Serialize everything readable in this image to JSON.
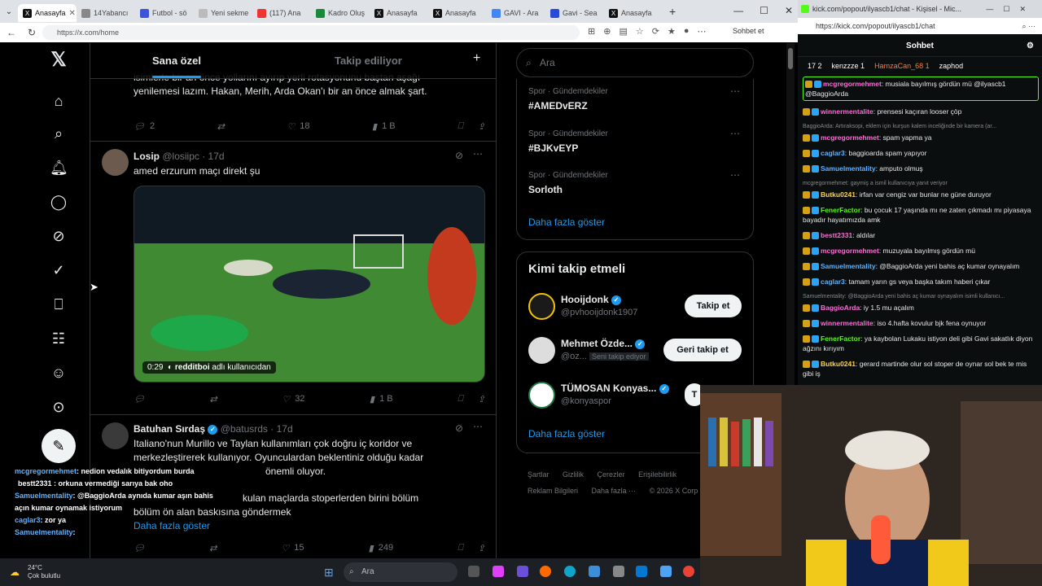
{
  "browser_left": {
    "tabs": [
      {
        "label": "Anasayfa",
        "active": true
      },
      {
        "label": "14Yabancı",
        "active": false
      },
      {
        "label": "Futbol - sö",
        "active": false
      },
      {
        "label": "Yeni sekme",
        "active": false
      },
      {
        "label": "(117) Ana",
        "active": false
      },
      {
        "label": "Kadro Oluş",
        "active": false
      },
      {
        "label": "Anasayfa",
        "active": false
      },
      {
        "label": "Anasayfa",
        "active": false
      },
      {
        "label": "GAVI - Ara",
        "active": false
      },
      {
        "label": "Gavi - Sea",
        "active": false
      },
      {
        "label": "Anasayfa",
        "active": false
      }
    ],
    "url": "https://x.com/home",
    "sohbet_label": "Sohbet et"
  },
  "feed": {
    "tab_selected": "Sana özel",
    "tab_other": "Takip ediliyor",
    "post0": {
      "text_line1": "isimlerle bir an önce yollarını ayırıp yerli rotasyonunu baştan aşağı",
      "text_line2": "yenilemesi lazım. Hakan, Merih, Arda Okan'ı bir an önce almak şart.",
      "replies": "2",
      "likes": "18",
      "views": "1 B"
    },
    "post1": {
      "name": "Losip",
      "handle": "@losiipc · 17d",
      "text": "amed erzurum maçı direkt şu",
      "video_time": "0:29",
      "video_credit_user": "redditboi",
      "video_credit_suffix": "adlı kullanıcıdan",
      "replies": "",
      "likes": "32",
      "views": "1 B"
    },
    "post2": {
      "name": "Batuhan Sırdaş",
      "handle": "@batusrds · 17d",
      "line1": "Italiano'nun Murillo ve Taylan kullanımları çok doğru iç koridor ve",
      "line2": "merkezleştirerek kullanıyor. Oyunculardan beklentiniz olduğu kadar",
      "line3": "önemli oluyor.",
      "line4": "kulan maçlarda stoperlerden birini bölüm",
      "line5": "bölüm ön alan baskısına göndermek",
      "show_more": "Daha fazla göster",
      "likes": "15",
      "views": "249"
    }
  },
  "sidebar_right": {
    "search_placeholder": "Ara",
    "trends": [
      {
        "category": "Spor · Gündemdekiler",
        "name": "#AMEDvERZ"
      },
      {
        "category": "Spor · Gündemdekiler",
        "name": "#BJKvEYP"
      },
      {
        "category": "Spor · Gündemdekiler",
        "name": "Sorloth"
      }
    ],
    "show_more": "Daha fazla göster",
    "who_title": "Kimi takip etmeli",
    "who": [
      {
        "name": "Hooijdonk",
        "handle": "@pvhooijdonk1907",
        "button": "Takip et",
        "badge": ""
      },
      {
        "name": "Mehmet Özde...",
        "handle": "@oz...",
        "button": "Geri takip et",
        "badge": "Seni takip ediyor"
      },
      {
        "name": "TÜMOSAN Konyas...",
        "handle": "@konyaspor",
        "button": "T",
        "badge": ""
      }
    ],
    "who_show_more": "Daha fazla göster",
    "footer": [
      "Şartlar",
      "Gizlilik",
      "Çerezler",
      "Erişilebilirlik",
      "Reklam Bilgileri",
      "Daha fazla ···",
      "© 2026 X Corp"
    ]
  },
  "overlay_chat": [
    {
      "user": "mcgregormehmet",
      "text": ": nedion vedalık bitiyordum burda"
    },
    {
      "user": "bestt2331",
      "text": ": orkuna vermediği sarıya bak oho"
    },
    {
      "user": "Samuelmentality",
      "text": ": @BaggioArda aynıda kumar aşın bahis"
    },
    {
      "user": "",
      "text": "açın kumar oynamak istiyorum"
    },
    {
      "user": "caglar3",
      "text": ": zor ya"
    },
    {
      "user": "Samuelmentality",
      "text": ":"
    }
  ],
  "browser_right": {
    "title": "kick.com/popout/ilyascb1/chat - Kişisel - Mic...",
    "url": "https://kick.com/popout/ilyascb1/chat",
    "chat_title": "Sohbet",
    "gifters": [
      "17 2",
      "kenzzze 1",
      "HamzaCan_68 1",
      "zaphod"
    ],
    "messages": [
      {
        "type": "hl",
        "user": "mcgregormehmet",
        "color": "#ff6bd6",
        "text": ": musiala bayılmış gördün mü @ilyascb1 @BaggioArda"
      },
      {
        "type": "msg",
        "user": "winnermentalite",
        "color": "#ff6bd6",
        "text": ": prensesi kaçıran looser çöp"
      },
      {
        "type": "reply",
        "text": "BaggioArda: Artıraksopi, eklem için kurşun kalem inceliğinde bir kamera (ar..."
      },
      {
        "type": "msg",
        "user": "mcgregormehmet",
        "color": "#ff6bd6",
        "text": ": spam yapma ya"
      },
      {
        "type": "msg",
        "user": "caglar3",
        "color": "#5eb2ff",
        "text": ": baggioarda spam yapıyor"
      },
      {
        "type": "msg",
        "user": "Samuelmentality",
        "color": "#5eb2ff",
        "text": ": amputo olmuş"
      },
      {
        "type": "reply",
        "text": "mcgregormehmet: gaymiş a ismil kullanıcıya yanıt veriyor"
      },
      {
        "type": "msg",
        "user": "Butku0241",
        "color": "#ffd24a",
        "text": ": irfan var cengiz var bunlar ne güne duruyor"
      },
      {
        "type": "msg",
        "user": "FenerFactor",
        "color": "#53fc18",
        "text": ": bu çocuk 17 yaşında mı ne zaten çıkmadı mı piyasaya bayadır hayatımızda amk"
      },
      {
        "type": "msg",
        "user": "bestt2331",
        "color": "#ff6bd6",
        "text": ": aldılar"
      },
      {
        "type": "msg",
        "user": "mcgregormehmet",
        "color": "#ff6bd6",
        "text": ": muzuyala bayılmış gördün mü"
      },
      {
        "type": "msg",
        "user": "Samuelmentality",
        "color": "#5eb2ff",
        "text": ": @BaggioArda yeni bahis aç kumar oynayalım"
      },
      {
        "type": "msg",
        "user": "caglar3",
        "color": "#5eb2ff",
        "text": ": tamam yarın gs veya başka takım haberi çıkar"
      },
      {
        "type": "reply",
        "text": "Samuelmentality: @BaggioArda yeni bahis aç kumar oynayalım isimli kullanıcı..."
      },
      {
        "type": "msg",
        "user": "BaggioArda",
        "color": "#ff6bd6",
        "text": ": iy 1.5 mu açalım"
      },
      {
        "type": "msg",
        "user": "winnermentalite",
        "color": "#ff6bd6",
        "text": ": iso 4.hafta kovulur bjk fena oynuyor"
      },
      {
        "type": "msg",
        "user": "FenerFactor",
        "color": "#53fc18",
        "text": ": ya kaybolan Lukaku istiyon deli gibi Gavi sakatlık diyon ağzını kırıyım"
      },
      {
        "type": "msg",
        "user": "Butku0241",
        "color": "#ffd24a",
        "text": ": gerard martinde olur sol stoper de oynar sol bek te mis gibi iş"
      }
    ]
  },
  "taskbar": {
    "temp": "24°C",
    "weather": "Çok bulutlu",
    "search": "Ara"
  },
  "colors": {
    "accent": "#1d9bf0",
    "kick_green": "#53fc18"
  }
}
